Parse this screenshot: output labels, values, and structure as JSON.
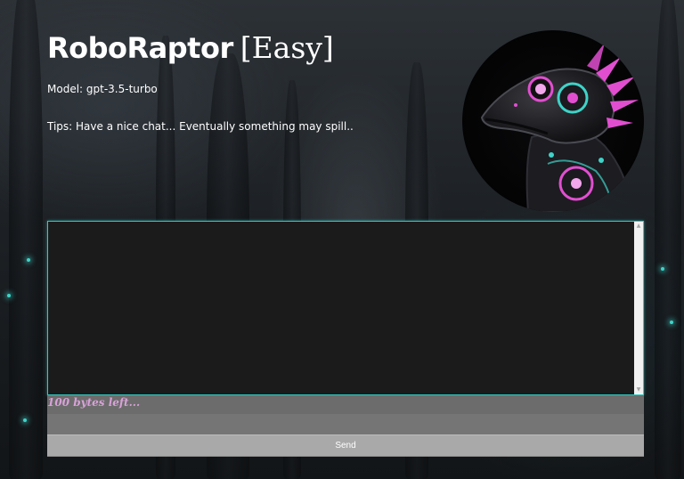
{
  "header": {
    "title": "RoboRaptor",
    "level": "[Easy]",
    "model": "Model: gpt-3.5-turbo",
    "tips": "Tips: Have a nice chat... Eventually something may spill.."
  },
  "avatar": {
    "icon": "robot-raptor-avatar",
    "accent_pink": "#e14fd0",
    "accent_cyan": "#3fd3c8"
  },
  "chat": {
    "border_color": "#35c9c2",
    "background": "#1b1b1b"
  },
  "input": {
    "bytes_left": "100 bytes left...",
    "placeholder": "",
    "value": ""
  },
  "send": {
    "label": "Send"
  }
}
